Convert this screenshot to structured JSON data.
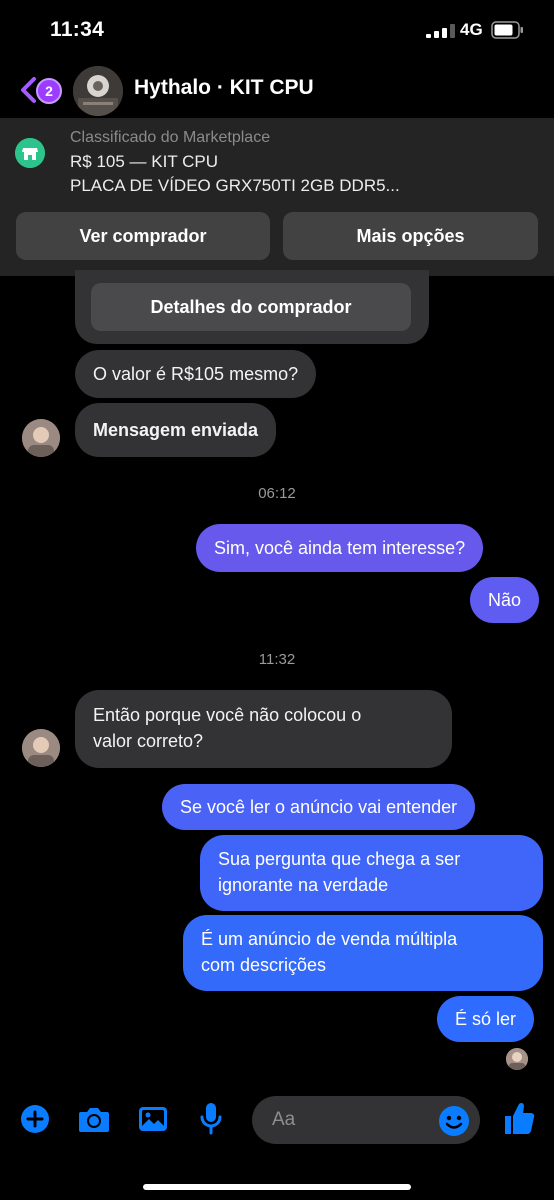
{
  "status_bar": {
    "time": "11:34",
    "network": "4G"
  },
  "header": {
    "back_badge": "2",
    "title": "Hythalo · KIT CPU"
  },
  "marketplace": {
    "subtitle": "Classificado do Marketplace",
    "price_line": "R$ 105 — KIT CPU",
    "description": "PLACA DE VÍDEO GRX750TI 2GB DDR5...",
    "see_buyer_label": "Ver comprador",
    "more_options_label": "Mais opções"
  },
  "buyer_card": {
    "details_label": "Detalhes do comprador"
  },
  "messages": {
    "m1": "O valor é R$105 mesmo?",
    "m2": "Mensagem enviada",
    "ts1": "06:12",
    "m3": "Sim, você ainda tem interesse?",
    "m4": "Não",
    "ts2": "11:32",
    "m5_line1": "Então porque você não colocou o",
    "m5_line2": "valor correto?",
    "m6": "Se você ler o anúncio vai entender",
    "m7_line1": "Sua pergunta que chega a ser",
    "m7_line2": "ignorante na verdade",
    "m8_line1": "É um anúncio de venda múltipla",
    "m8_line2": "com descrições",
    "m9": "É só ler"
  },
  "composer": {
    "placeholder": "Aa"
  },
  "colors": {
    "accent": "#0a7cff",
    "bubble_in": "#333335",
    "bubble_out_top": "#6b5cf0",
    "bubble_out_bottom": "#2f6bff",
    "badge": "#9b3cff",
    "marketplace_icon": "#2cc48c"
  }
}
